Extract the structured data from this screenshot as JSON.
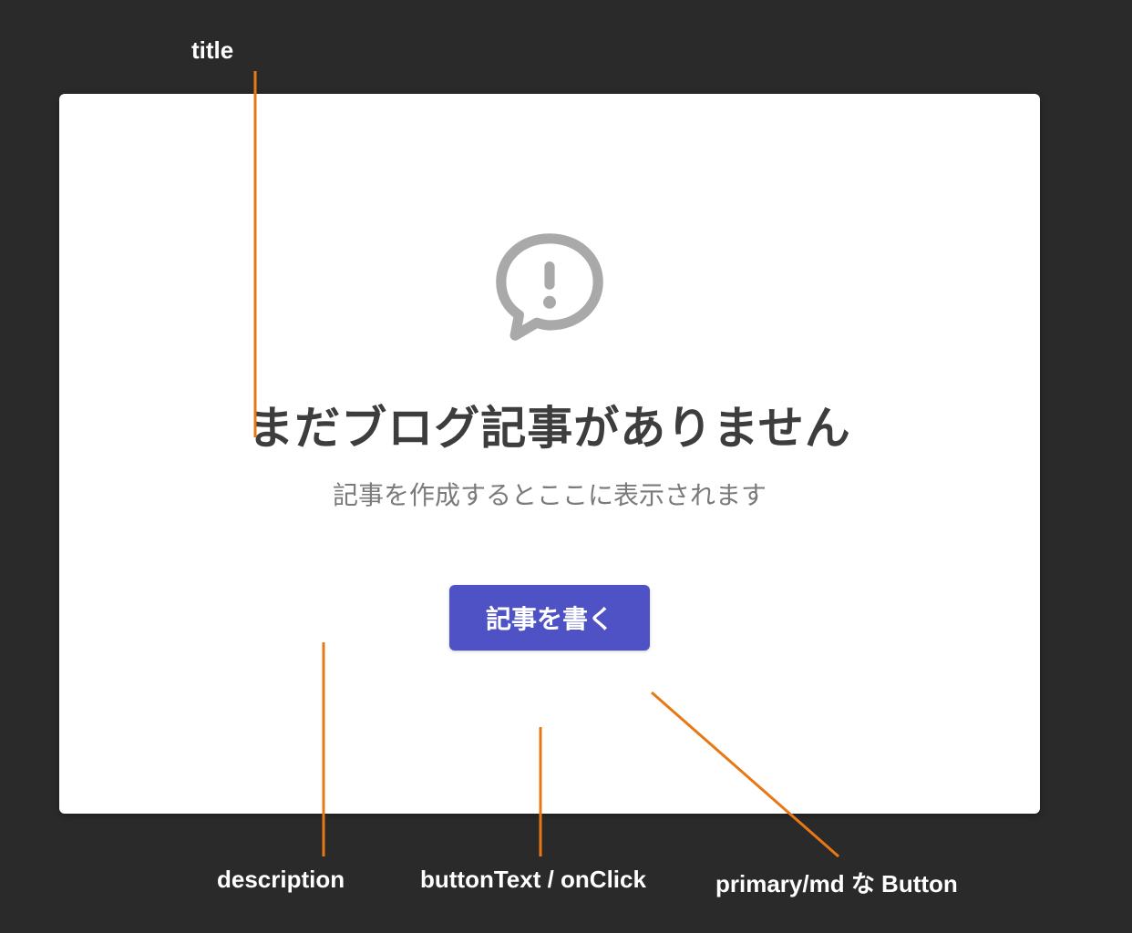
{
  "annotations": {
    "top_title": "title",
    "bottom_description": "description",
    "bottom_buttontext": "buttonText / onClick",
    "bottom_primary": "primary/md な Button"
  },
  "card": {
    "title": "まだブログ記事がありません",
    "description": "記事を作成するとここに表示されます",
    "button_label": "記事を書く"
  },
  "icon": {
    "name": "speech-bubble-exclamation"
  },
  "colors": {
    "callout": "#e87815",
    "button": "#4f52c4",
    "background": "#2a2a2a",
    "card_bg": "#ffffff",
    "title_text": "#3d3d3d",
    "desc_text": "#7a7a7a",
    "icon": "#a9a9a9"
  }
}
